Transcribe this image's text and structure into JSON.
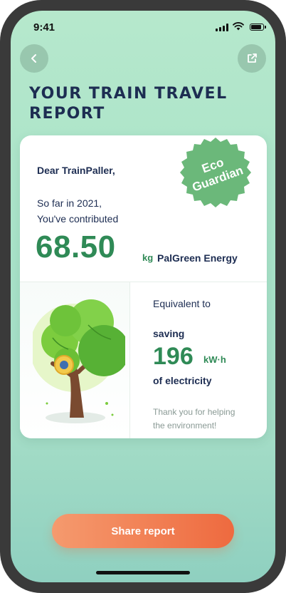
{
  "status": {
    "time": "9:41"
  },
  "header": {
    "title": "YOUR TRAIN TRAVEL REPORT"
  },
  "badge": {
    "line1": "Eco",
    "line2": "Guardian"
  },
  "card": {
    "greeting": "Dear TrainPaller,",
    "so_far": "So far in 2021,",
    "contributed": "You've contributed",
    "amount": "68.50",
    "amount_unit": "kg",
    "energy_label": "PalGreen Energy",
    "equivalent": "Equivalent to",
    "saving": "saving",
    "kwh_value": "196",
    "kwh_unit": "kW·h",
    "of_electricity": "of electricity",
    "thanks_line1": "Thank you for helping",
    "thanks_line2": "the environment!"
  },
  "footer": {
    "share_label": "Share report"
  },
  "colors": {
    "accent_green": "#2f8a56",
    "navy": "#1d2d52",
    "cta_orange": "#ee6a3f"
  }
}
